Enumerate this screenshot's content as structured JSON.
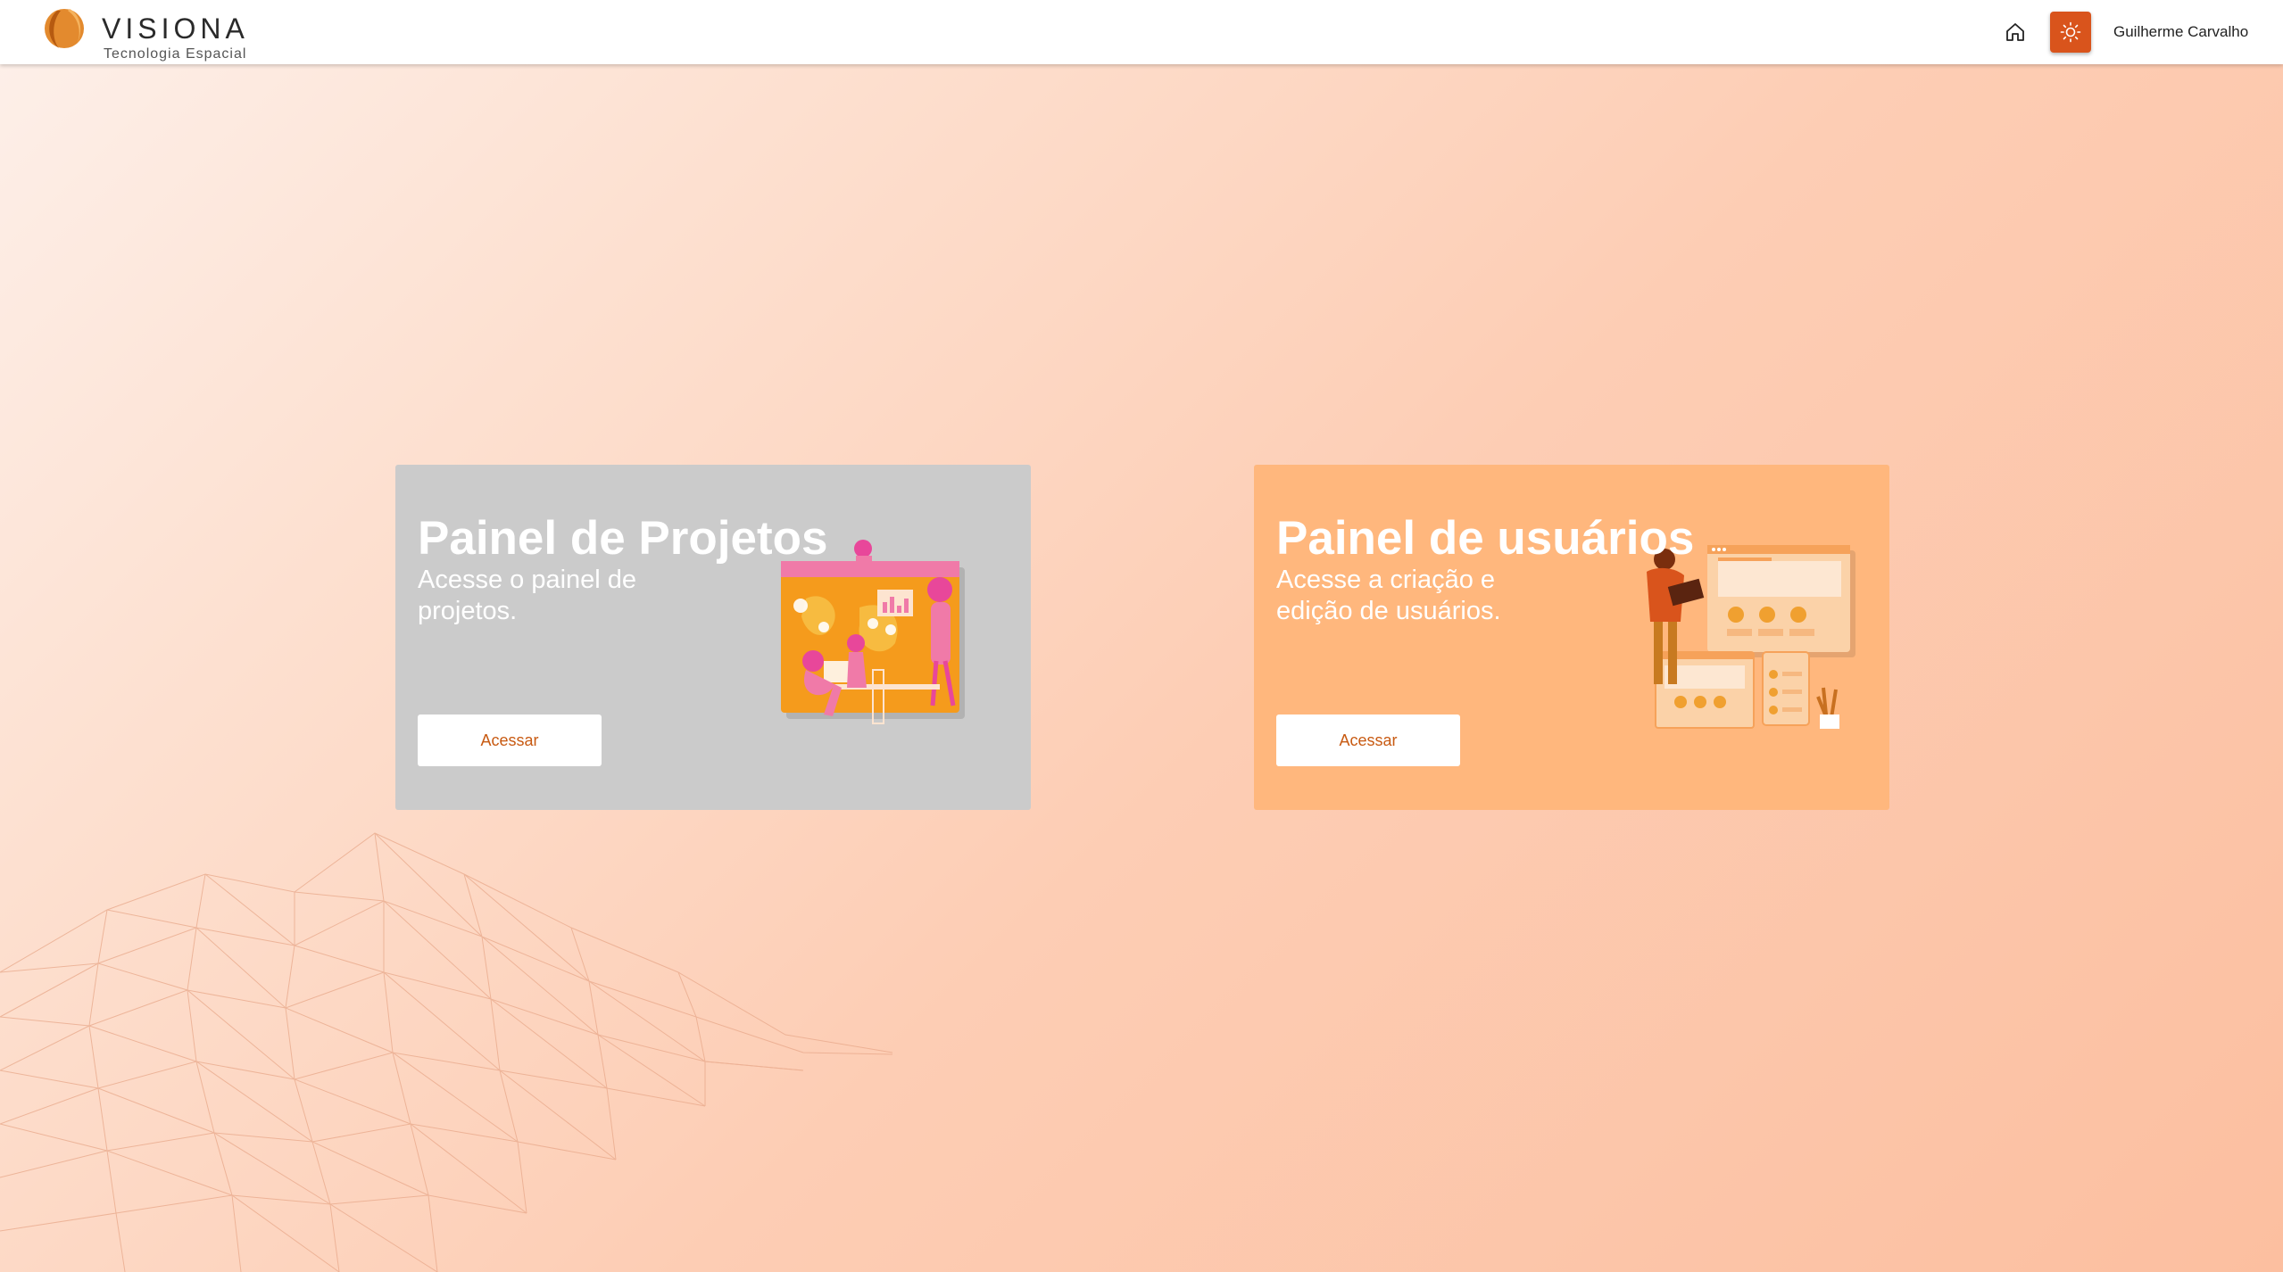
{
  "header": {
    "logo_name": "VISIONA",
    "logo_tagline": "Tecnologia Espacial",
    "home_icon": "home-icon",
    "theme_icon": "sun-icon",
    "user_name": "Guilherme Carvalho"
  },
  "cards": [
    {
      "title": "Painel de Projetos",
      "description": "Acesse o painel de projetos.",
      "button_label": "Acessar",
      "illustration": "projects-illustration"
    },
    {
      "title": "Painel de usuários",
      "description": "Acesse a criação e edição de usuários.",
      "button_label": "Acessar",
      "illustration": "users-illustration"
    }
  ],
  "colors": {
    "accent": "#d9541c",
    "projects_card_bg": "#cbcbcb",
    "users_card_bg": "#ffb77d",
    "button_text": "#c85a12"
  }
}
